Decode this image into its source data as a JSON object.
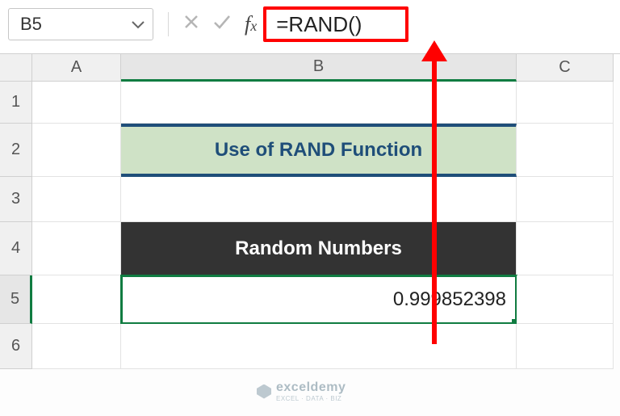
{
  "nameBox": {
    "value": "B5"
  },
  "formulaBar": {
    "formula": "=RAND()"
  },
  "columns": {
    "A": "A",
    "B": "B",
    "C": "C"
  },
  "rows": {
    "r1": "1",
    "r2": "2",
    "r3": "3",
    "r4": "4",
    "r5": "5",
    "r6": "6"
  },
  "cells": {
    "B2": "Use of RAND Function",
    "B4": "Random Numbers",
    "B5": "0.999852398"
  },
  "watermark": {
    "brand": "exceldemy",
    "tagline": "EXCEL · DATA · BIZ"
  }
}
